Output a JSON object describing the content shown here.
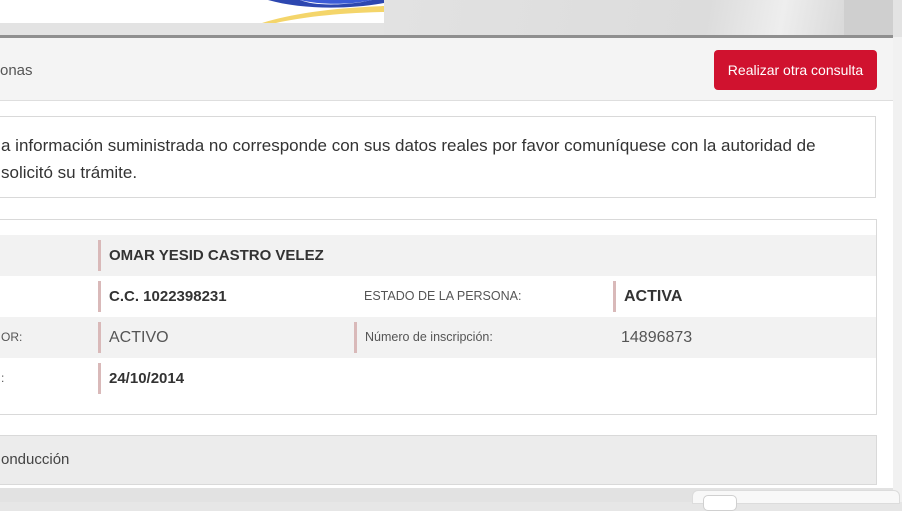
{
  "header": {
    "section_label": "onas",
    "action_button": "Realizar otra consulta"
  },
  "notice": {
    "text": "a información suministrada no corresponde con sus datos reales por favor comuníquese con la autoridad de solicitó su trámite."
  },
  "person": {
    "rows": [
      {
        "label": "",
        "value": "OMAR YESID CASTRO VELEZ"
      },
      {
        "label": "",
        "value": "C.C. 1022398231",
        "label2": "ESTADO DE LA PERSONA:",
        "value2": "ACTIVA"
      },
      {
        "label": "OR:",
        "value": "ACTIVO",
        "label2": "Número de inscripción:",
        "value2": "14896873"
      },
      {
        "label": ":",
        "value": "24/10/2014"
      }
    ]
  },
  "sections": {
    "conduccion_label": "onducción"
  },
  "colors": {
    "primary_button": "#d0122f",
    "row_stripe": "#f2f2f2",
    "separator": "#d9b9b9"
  }
}
